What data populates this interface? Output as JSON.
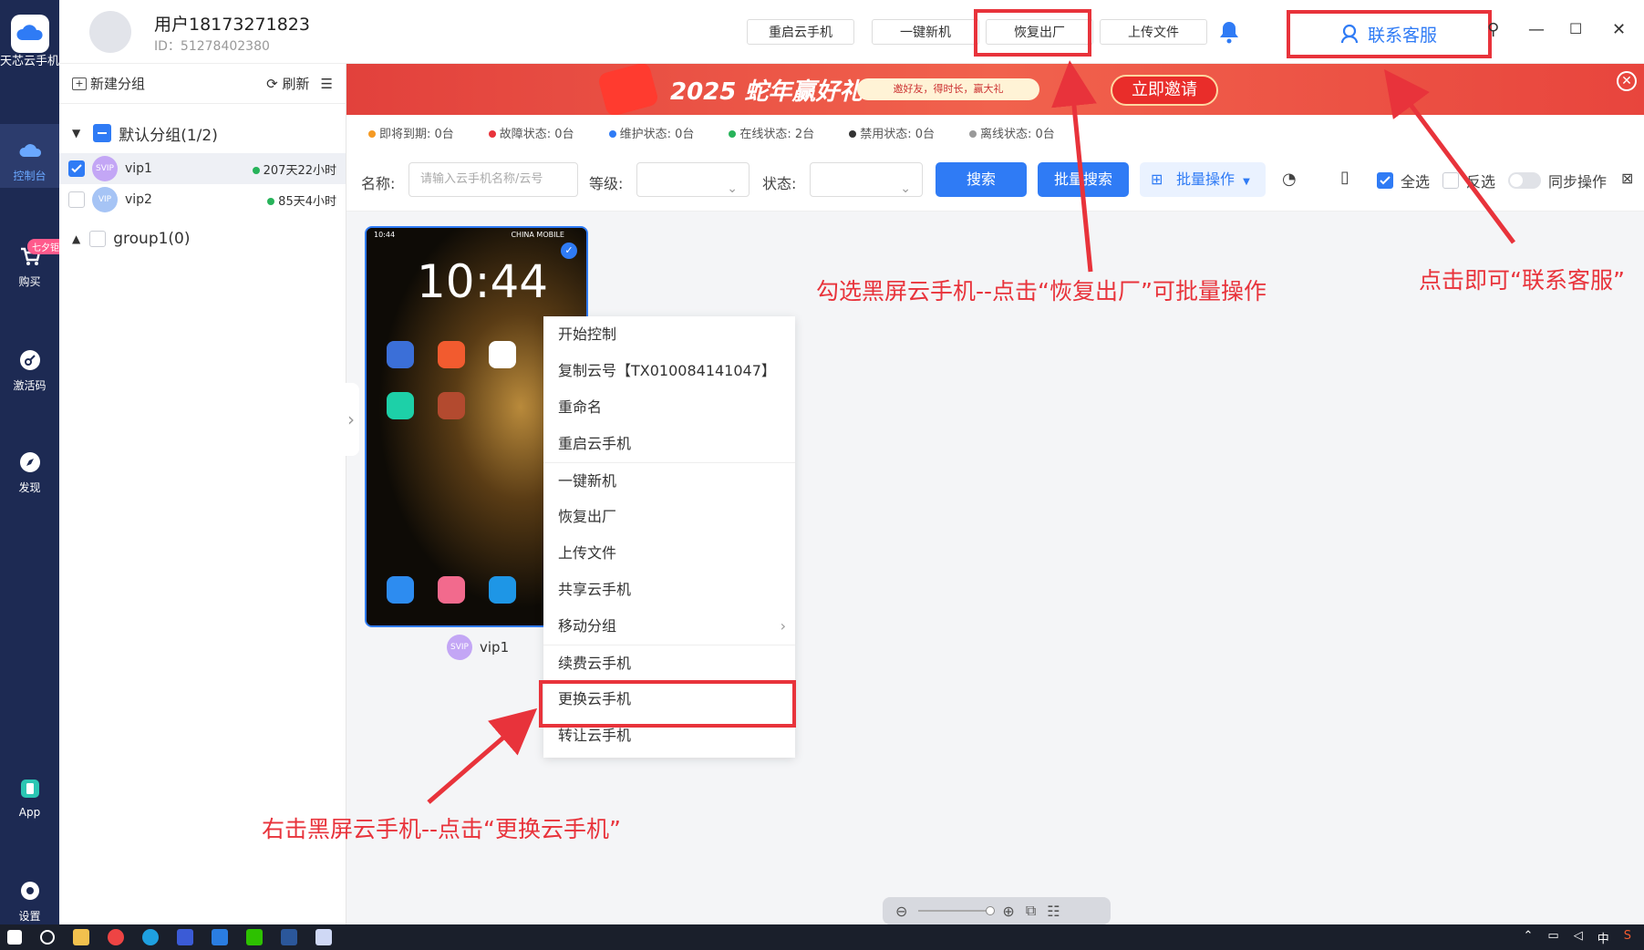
{
  "app": {
    "logo_text": "天芯云手机"
  },
  "rail": {
    "items": [
      {
        "label": "控制台"
      },
      {
        "label": "购买"
      },
      {
        "label": "激活码"
      },
      {
        "label": "发现"
      },
      {
        "label": "App"
      },
      {
        "label": "设置"
      }
    ],
    "promo_badge": "七夕钜惠"
  },
  "header": {
    "username": "用户18173271823",
    "user_id": "ID：51278402380",
    "buttons": {
      "restart": "重启云手机",
      "new_device": "一键新机",
      "factory_reset": "恢复出厂",
      "upload": "上传文件"
    },
    "customer_service": "联系客服"
  },
  "side": {
    "new_group": "新建分组",
    "refresh": "刷新",
    "default_group": "默认分组(1/2)",
    "devices": [
      {
        "name": "vip1",
        "time": "207天22小时"
      },
      {
        "name": "vip2",
        "time": "85天4小时"
      }
    ],
    "group1": "group1(0)"
  },
  "banner": {
    "title": "2025 蛇年赢好礼",
    "subtitle": "邀好友，得时长，赢大礼",
    "invite": "立即邀请"
  },
  "status": [
    {
      "label": "即将到期: 0台",
      "color": "#f59a23"
    },
    {
      "label": "故障状态: 0台",
      "color": "#e8333b"
    },
    {
      "label": "维护状态: 0台",
      "color": "#2f7bf5"
    },
    {
      "label": "在线状态: 2台",
      "color": "#27b35a"
    },
    {
      "label": "禁用状态: 0台",
      "color": "#333333"
    },
    {
      "label": "离线状态: 0台",
      "color": "#999999"
    }
  ],
  "filter": {
    "name_label": "名称:",
    "name_placeholder": "请输入云手机名称/云号",
    "level_label": "等级:",
    "state_label": "状态:",
    "search": "搜索",
    "batch_search": "批量搜索",
    "batch_ops": "批量操作",
    "select_all": "全选",
    "invert": "反选",
    "sync": "同步操作"
  },
  "phone": {
    "time": "10:44",
    "status_left": "10:44",
    "status_right": "CHINA MOBILE",
    "name": "vip1"
  },
  "context_menu": [
    "开始控制",
    "复制云号【TX010084141047】",
    "重命名",
    "重启云手机",
    "一键新机",
    "恢复出厂",
    "上传文件",
    "共享云手机",
    "移动分组",
    "续费云手机",
    "更换云手机",
    "转让云手机"
  ],
  "annotations": {
    "factory": "勾选黑屏云手机--点击“恢复出厂”可批量操作",
    "service": "点击即可“联系客服”",
    "replace": "右击黑屏云手机--点击“更换云手机”"
  },
  "colors": {
    "accent": "#2f7bf5",
    "annotation": "#e8333b",
    "rail": "#1d2a53"
  }
}
